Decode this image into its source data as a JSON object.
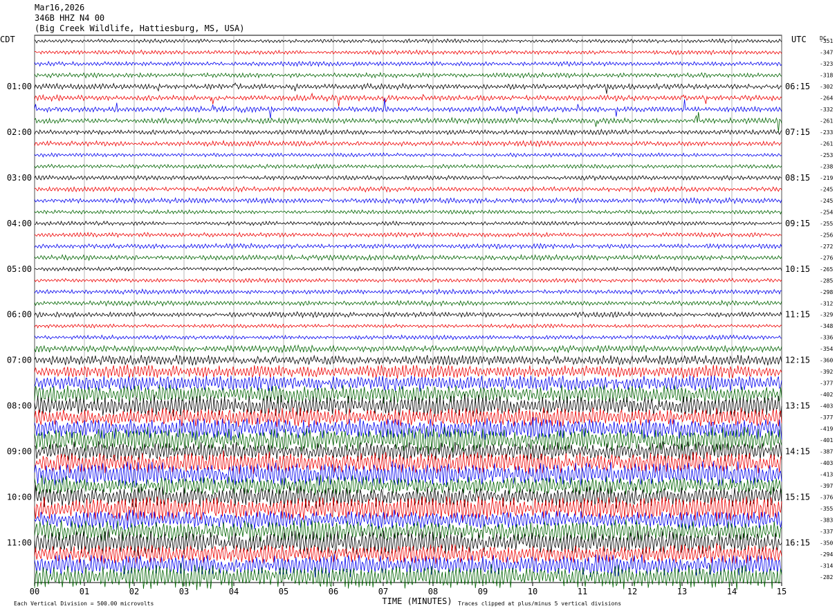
{
  "header": {
    "date": "Mar16,2026",
    "station": "346B HHZ N4 00",
    "location": "(Big Creek Wildlife, Hattiesburg, MS, USA)"
  },
  "chart_data": {
    "type": "line",
    "title": "Mar16,2026",
    "left_axis_title": "CDT",
    "right_axis_title": "UTC",
    "dc_title": "DC",
    "xlabel": "TIME (MINUTES)",
    "x_ticks": [
      "00",
      "01",
      "02",
      "03",
      "04",
      "05",
      "06",
      "07",
      "08",
      "09",
      "10",
      "11",
      "12",
      "13",
      "14",
      "15"
    ],
    "xlim": [
      0,
      15
    ],
    "left_time_labels": [
      "01:00",
      "02:00",
      "03:00",
      "04:00",
      "05:00",
      "06:00",
      "07:00",
      "08:00",
      "09:00",
      "10:00",
      "11:00"
    ],
    "right_time_labels": [
      "06:15",
      "07:15",
      "08:15",
      "09:15",
      "10:15",
      "11:15",
      "12:15",
      "13:15",
      "14:15",
      "15:15",
      "16:15"
    ],
    "dc_offsets": [
      "-351",
      "-347",
      "-323",
      "-318",
      "-302",
      "-264",
      "-332",
      "-261",
      "-233",
      "-261",
      "-253",
      "-238",
      "-219",
      "-245",
      "-245",
      "-254",
      "-255",
      "-256",
      "-272",
      "-276",
      "-265",
      "-285",
      "-298",
      "-312",
      "-329",
      "-348",
      "-336",
      "-354",
      "-360",
      "-392",
      "-377",
      "-402",
      "-403",
      "-377",
      "-419",
      "-401",
      "-387",
      "-403",
      "-413",
      "-397",
      "-376",
      "-355",
      "-383",
      "-337",
      "-350",
      "-294",
      "-314",
      "-282"
    ],
    "trace_colors": [
      "#000000",
      "#ee0000",
      "#0000ee",
      "#006400"
    ],
    "grid": true,
    "footer_left": "Each Vertical Division =  500.00 microvolts",
    "footer_right": "Traces clipped at plus/minus 5 vertical divisions"
  }
}
